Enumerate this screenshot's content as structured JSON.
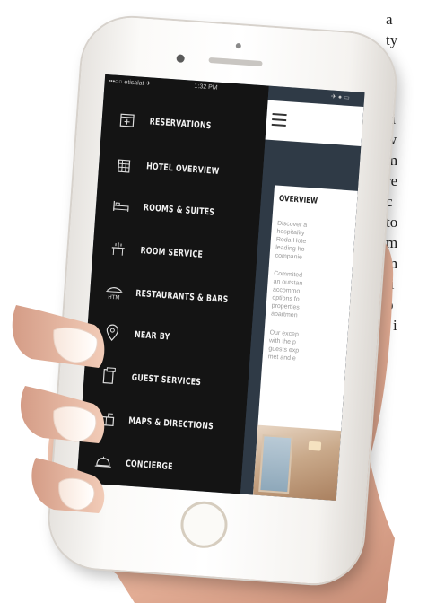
{
  "background_text": [
    "a",
    "ty",
    "",
    "p",
    "b",
    "si",
    "w",
    "m",
    "re",
    "c",
    "to",
    "m",
    "m",
    "ti",
    "o",
    "i"
  ],
  "status_bar": {
    "carrier": "•••○○ etisalat ✈",
    "time": "1:32 PM",
    "right": "✈ ● ▭"
  },
  "menu": {
    "items": [
      {
        "label": "RESERVATIONS",
        "icon": "calendar-icon"
      },
      {
        "label": "HOTEL OVERVIEW",
        "icon": "hotel-building-icon"
      },
      {
        "label": "ROOMS & SUITES",
        "icon": "bed-icon"
      },
      {
        "label": "ROOM SERVICE",
        "icon": "room-service-icon"
      },
      {
        "label": "RESTAURANTS & BARS",
        "icon": "restaurant-icon"
      },
      {
        "label": "NEAR BY",
        "icon": "location-pin-icon"
      },
      {
        "label": "GUEST SERVICES",
        "icon": "guest-services-icon"
      },
      {
        "label": "MAPS & DIRECTIONS",
        "icon": "map-icon"
      },
      {
        "label": "CONCIERGE",
        "icon": "concierge-bell-icon"
      }
    ]
  },
  "content": {
    "title": "OVERVIEW",
    "para1": [
      "Discover a",
      "hospitality",
      "Roda Hote",
      "leading ho",
      "companie"
    ],
    "para2": [
      "Commited",
      "an outstan",
      "accommo",
      "options fo",
      "properties",
      "apartmen"
    ],
    "para3": [
      "Our excep",
      "with the p",
      "guests exp",
      "met and e"
    ]
  },
  "colors": {
    "menu_bg": "#141414",
    "content_bg": "#2f3a46",
    "menu_text": "#f2f2f2"
  }
}
